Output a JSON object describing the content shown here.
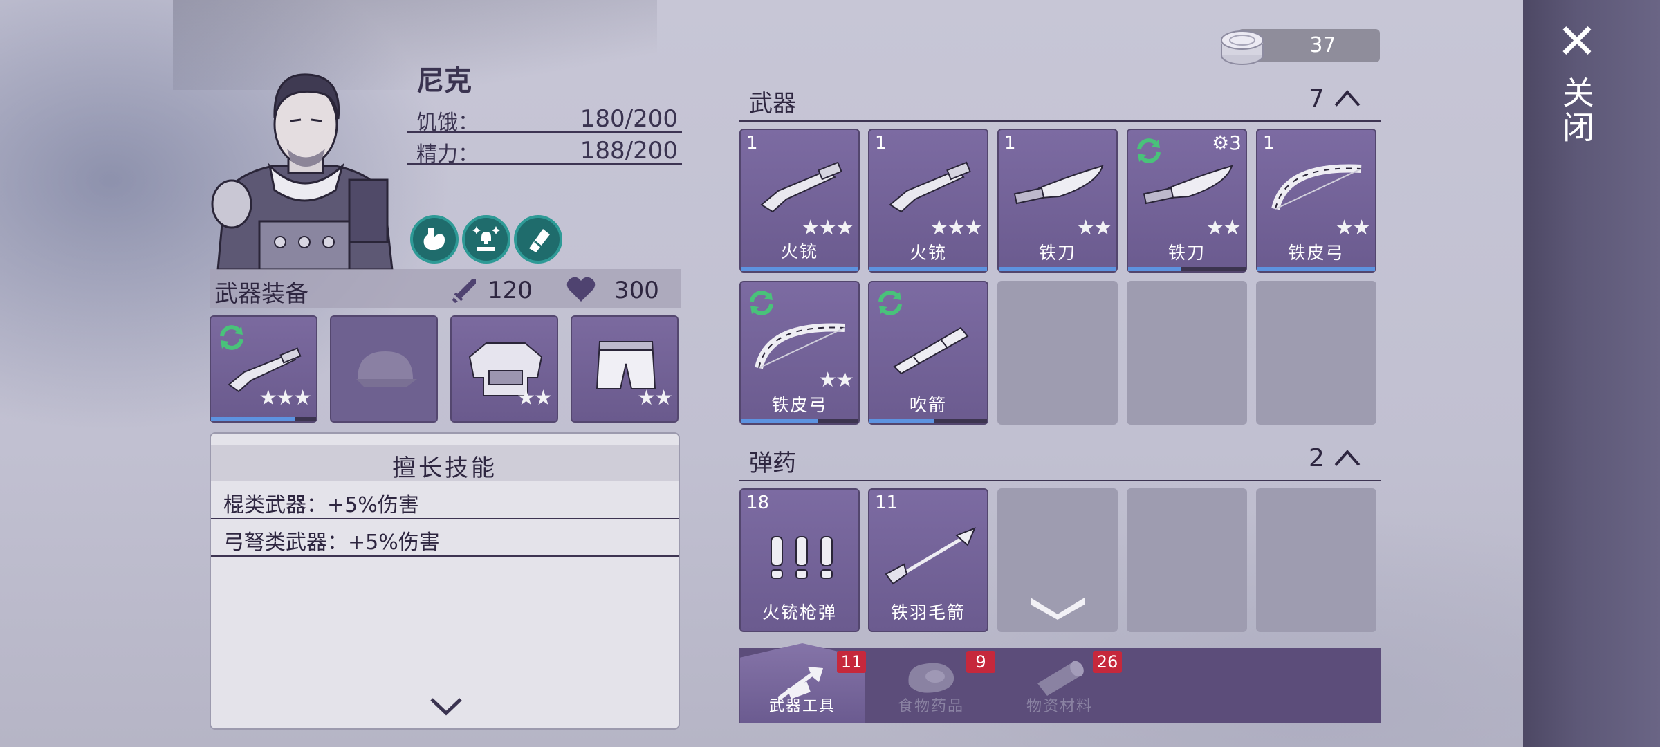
{
  "currency": {
    "amount": "37"
  },
  "close": {
    "label": "关闭"
  },
  "character": {
    "name": "尼克",
    "stats": [
      {
        "label": "饥饿：",
        "value": "180/200"
      },
      {
        "label": "精力：",
        "value": "188/200"
      }
    ],
    "status_icons": [
      "stomach-icon",
      "sparkle-skull-icon",
      "bandage-icon"
    ]
  },
  "equipment": {
    "title": "武器装备",
    "attack": "120",
    "health": "300",
    "slots": [
      {
        "icon": "musket-icon",
        "stars": "★★★",
        "durability": 0.8,
        "cycle": true
      },
      {
        "icon": "cap-icon",
        "empty": true
      },
      {
        "icon": "armor-vest-icon",
        "stars": "★★"
      },
      {
        "icon": "shorts-icon",
        "stars": "★★"
      }
    ]
  },
  "skills": {
    "title": "擅长技能",
    "items": [
      "棍类武器：+5%伤害",
      "弓弩类武器：+5%伤害"
    ]
  },
  "weapons": {
    "title": "武器",
    "count": "7",
    "items": [
      {
        "qty": "1",
        "name": "火铳",
        "stars": "★★★",
        "icon": "musket-icon",
        "durability": 1.0
      },
      {
        "qty": "1",
        "name": "火铳",
        "stars": "★★★",
        "icon": "musket-icon",
        "durability": 1.0
      },
      {
        "qty": "1",
        "name": "铁刀",
        "stars": "★★",
        "icon": "knife-icon",
        "durability": 1.0
      },
      {
        "qty": "3",
        "name": "铁刀",
        "stars": "★★",
        "icon": "knife-icon",
        "durability": 0.45,
        "cycle": true,
        "gear": true
      },
      {
        "qty": "1",
        "name": "铁皮弓",
        "stars": "★★",
        "icon": "bow-icon",
        "durability": 1.0
      },
      {
        "name": "铁皮弓",
        "stars": "★★",
        "icon": "bow-icon",
        "durability": 0.65,
        "cycle": true
      },
      {
        "name": "吹箭",
        "stars": "",
        "icon": "blowpipe-icon",
        "durability": 0.55,
        "cycle": true
      }
    ]
  },
  "ammo": {
    "title": "弹药",
    "count": "2",
    "items": [
      {
        "qty": "18",
        "name": "火铳枪弹",
        "icon": "bullets-icon"
      },
      {
        "qty": "11",
        "name": "铁羽毛箭",
        "icon": "arrow-icon"
      }
    ]
  },
  "tabs": [
    {
      "label": "武器工具",
      "badge": "11",
      "icon": "axe-hammer-icon",
      "active": true
    },
    {
      "label": "食物药品",
      "badge": "9",
      "icon": "meat-icon",
      "active": false
    },
    {
      "label": "物资材料",
      "badge": "26",
      "icon": "log-icon",
      "active": false
    }
  ]
}
